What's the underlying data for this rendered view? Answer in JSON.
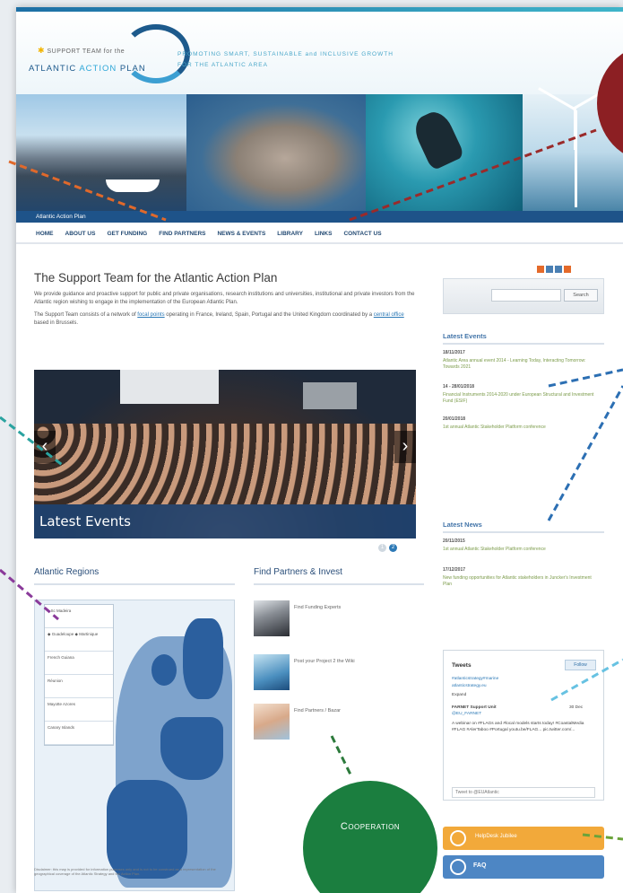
{
  "logo": {
    "top": "SUPPORT TEAM for the",
    "main_a": "ATLANTIC ",
    "main_b": "ACTION",
    "main_c": " PLAN"
  },
  "tagline": {
    "line1": "PROMOTING SMART, SUSTAINABLE and INCLUSIVE GROWTH",
    "line2": "FOR THE ATLANTIC AREA"
  },
  "crumb": "Atlantic Action Plan",
  "nav": [
    "HOME",
    "ABOUT US",
    "GET FUNDING",
    "FIND PARTNERS",
    "NEWS & EVENTS",
    "LIBRARY",
    "LINKS",
    "CONTACT US"
  ],
  "main": {
    "title": "The Support Team for the Atlantic Action Plan",
    "intro1": "We provide guidance and proactive support for public and private organisations, research institutions and universities, institutional and private investors from the Atlantic region wishing to engage in the implementation of the European Atlantic Plan.",
    "intro2a": "The Support Team consists of a network of ",
    "intro2_link1": "focal points",
    "intro2b": " operating in France, Ireland, Spain, Portugal and the United Kingdom coordinated by a ",
    "intro2_link2": "central office",
    "intro2c": " based in Brussels.",
    "slider_caption": "Latest Events",
    "prev": "‹",
    "next": "›",
    "dot1": "1",
    "dot2": "2"
  },
  "regions": {
    "title": "Atlantic Regions",
    "legend": [
      "▸ Sc Madeira",
      "◆ Guadeloupe  ◆ Martinique",
      "French Guiana",
      "Réunion",
      "Mayotte  Azores",
      "Canary Islands"
    ],
    "disclaimer": "Disclaimer: this map is provided for information purposes only and is not to be construed as a representation of the geographical coverage of the Atlantic Strategy and the Action Plan."
  },
  "partners": {
    "title": "Find Partners & Invest",
    "links": [
      "Find Funding Experts",
      "Post your Project 2 the Wiki",
      "Find Partners / Bazar"
    ]
  },
  "coop_label": "Cooperation",
  "sidebar": {
    "search_button": "Search",
    "search_placeholder": "",
    "events_title": "Latest Events",
    "events": [
      {
        "date": "18/11/2017",
        "text": "Atlantic Area annual event 2014 - Learning Today, Interacting Tomorrow: Towards 2021"
      },
      {
        "date": "14 - 28/01/2018",
        "text": "Financial Instruments 2014-2020 under European Structural and Investment Fund (ESIF)"
      },
      {
        "date": "20/01/2018",
        "text": "1st annual Atlantic Stakeholder Platform conference"
      }
    ],
    "news_title": "Latest News",
    "news": [
      {
        "date": "20/11/2015",
        "text": "1st annual Atlantic Stakeholder Platform conference"
      },
      {
        "date": "17/12/2017",
        "text": "New funding opportunities for Atlantic stakeholders in Juncker's Investment Plan"
      }
    ],
    "tweets": {
      "title": "Tweets",
      "follow": "Follow",
      "lines": [
        "#atlanticstrategy#marine",
        "atlanticstrategy.eu",
        "Expand"
      ],
      "author": "FARNET Support Unit",
      "handle": "@EU_FARNET",
      "time": "30 Dec",
      "body": "A webinar on #FLAGs and #local models starts today! #CoastalMedia #FLAG #AlerTaboo #Portugal youtu.be/FLAG... pic.twitter.com/...",
      "input": "Tweet to @EUAtlantic"
    },
    "helpdesk": "HelpDesk Jubilee",
    "faq": "FAQ"
  }
}
